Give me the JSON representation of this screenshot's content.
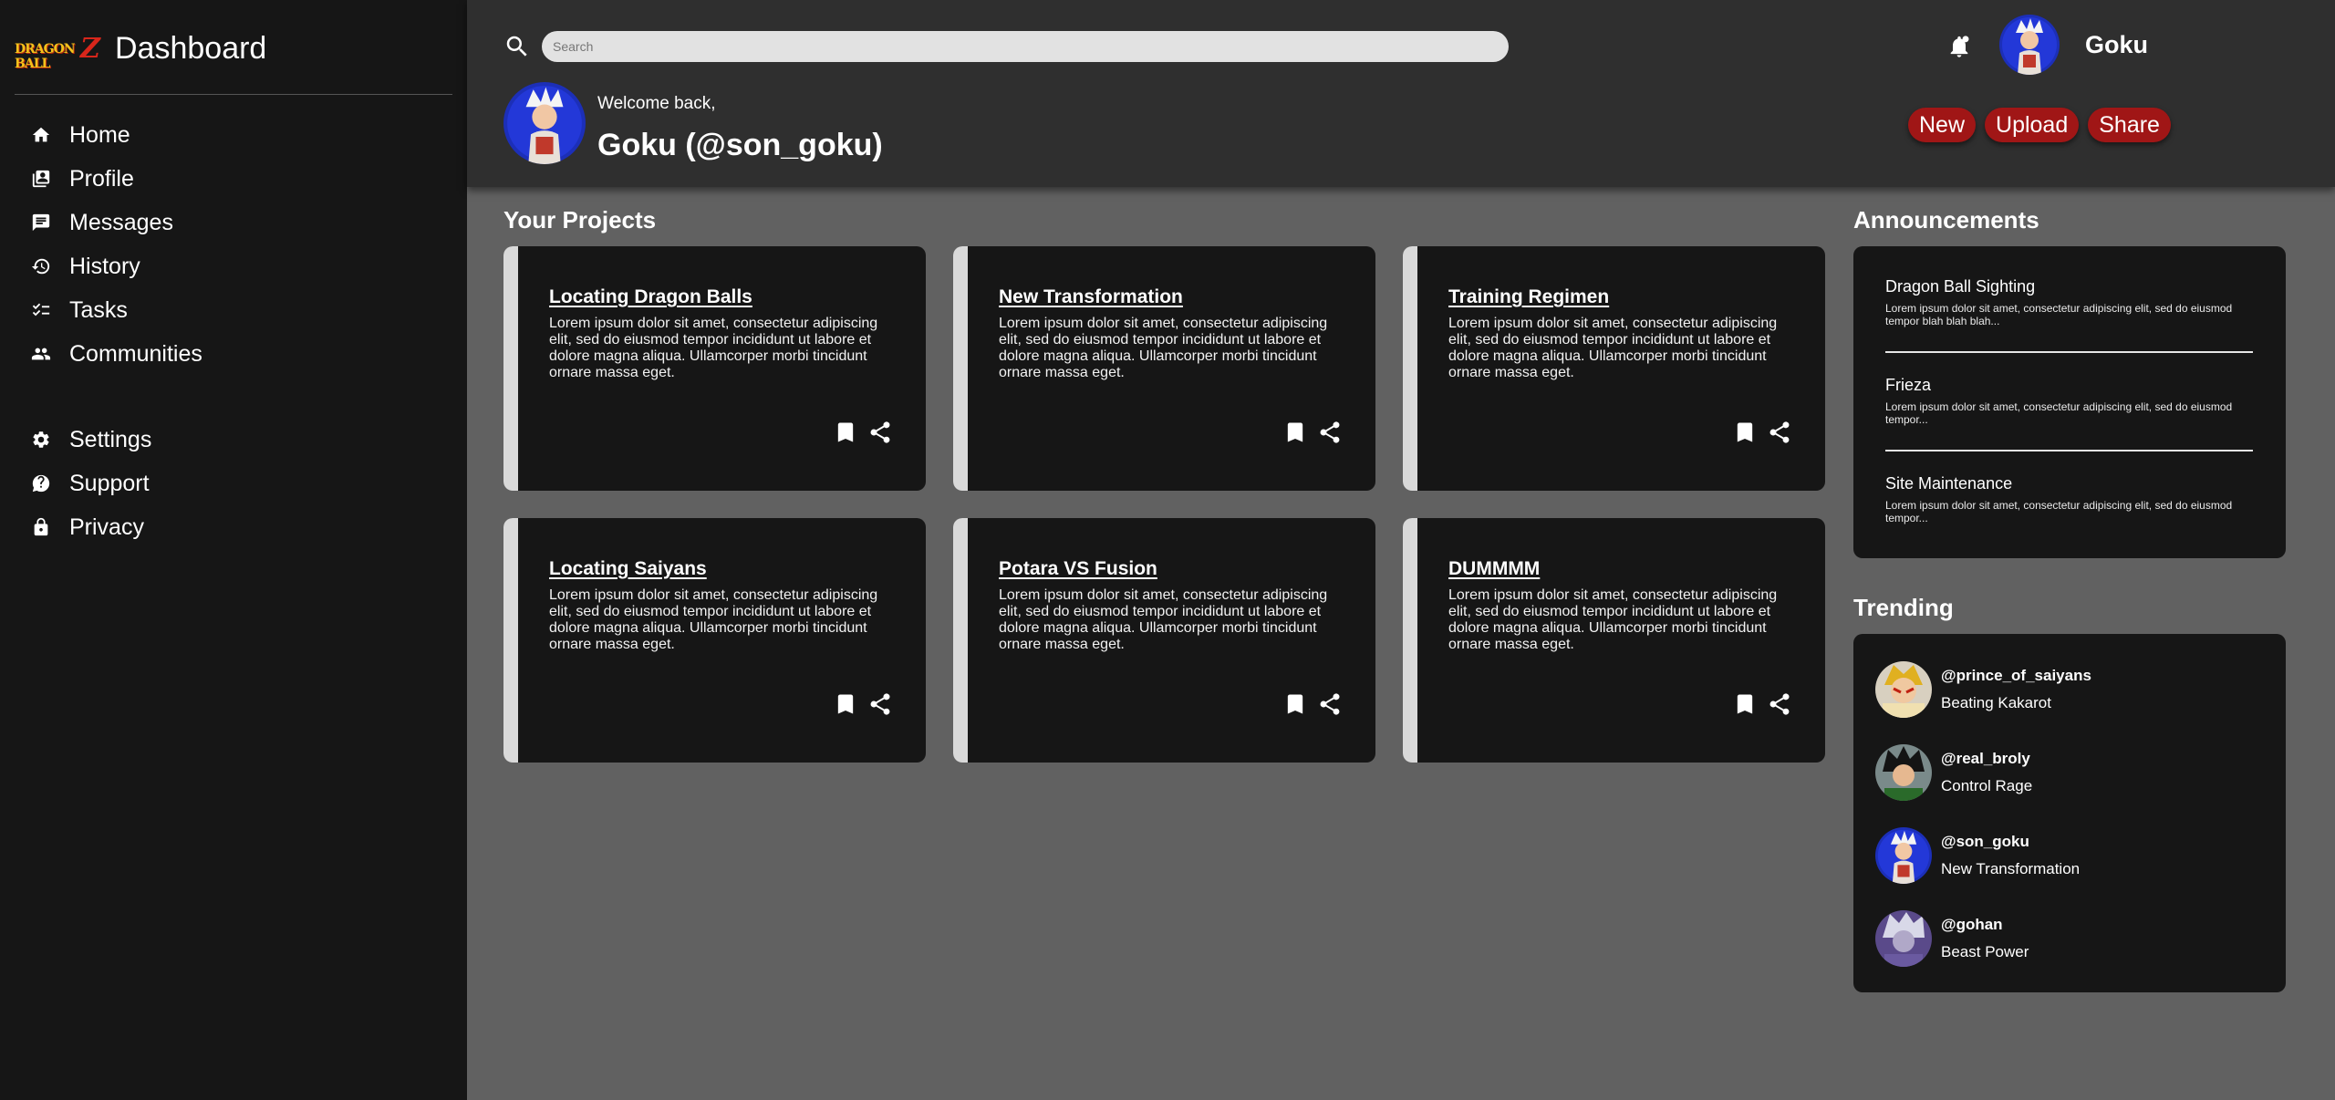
{
  "sidebar": {
    "logo_text": "DRAGON BALL",
    "logo_z": "Z",
    "title": "Dashboard",
    "items_main": [
      {
        "label": "Home",
        "icon": "home-icon"
      },
      {
        "label": "Profile",
        "icon": "profile-icon"
      },
      {
        "label": "Messages",
        "icon": "messages-icon"
      },
      {
        "label": "History",
        "icon": "history-icon"
      },
      {
        "label": "Tasks",
        "icon": "tasks-icon"
      },
      {
        "label": "Communities",
        "icon": "communities-icon"
      }
    ],
    "items_secondary": [
      {
        "label": "Settings",
        "icon": "settings-icon"
      },
      {
        "label": "Support",
        "icon": "support-icon"
      },
      {
        "label": "Privacy",
        "icon": "lock-icon"
      }
    ]
  },
  "header": {
    "search_placeholder": "Search",
    "username": "Goku",
    "welcome": "Welcome back,",
    "fullname": "Goku (@son_goku)",
    "actions": [
      "New",
      "Upload",
      "Share"
    ]
  },
  "projects": {
    "title": "Your Projects",
    "cards": [
      {
        "title": "Locating Dragon Balls",
        "body": "Lorem ipsum dolor sit amet, consectetur adipiscing elit, sed do eiusmod tempor incididunt ut labore et dolore magna aliqua. Ullamcorper morbi tincidunt ornare massa eget."
      },
      {
        "title": "New Transformation",
        "body": "Lorem ipsum dolor sit amet, consectetur adipiscing elit, sed do eiusmod tempor incididunt ut labore et dolore magna aliqua. Ullamcorper morbi tincidunt ornare massa eget."
      },
      {
        "title": "Training Regimen",
        "body": "Lorem ipsum dolor sit amet, consectetur adipiscing elit, sed do eiusmod tempor incididunt ut labore et dolore magna aliqua. Ullamcorper morbi tincidunt ornare massa eget."
      },
      {
        "title": "Locating Saiyans",
        "body": "Lorem ipsum dolor sit amet, consectetur adipiscing elit, sed do eiusmod tempor incididunt ut labore et dolore magna aliqua. Ullamcorper morbi tincidunt ornare massa eget."
      },
      {
        "title": "Potara VS Fusion",
        "body": "Lorem ipsum dolor sit amet, consectetur adipiscing elit, sed do eiusmod tempor incididunt ut labore et dolore magna aliqua. Ullamcorper morbi tincidunt ornare massa eget."
      },
      {
        "title": "DUMMMM",
        "body": "Lorem ipsum dolor sit amet, consectetur adipiscing elit, sed do eiusmod tempor incididunt ut labore et dolore magna aliqua. Ullamcorper morbi tincidunt ornare massa eget."
      }
    ]
  },
  "announcements": {
    "title": "Announcements",
    "items": [
      {
        "title": "Dragon Ball Sighting",
        "body": "Lorem ipsum dolor sit amet, consectetur adipiscing elit, sed do eiusmod tempor blah blah blah..."
      },
      {
        "title": "Frieza",
        "body": "Lorem ipsum dolor sit amet, consectetur adipiscing elit, sed do eiusmod tempor..."
      },
      {
        "title": "Site Maintenance",
        "body": "Lorem ipsum dolor sit amet, consectetur adipiscing elit, sed do eiusmod tempor..."
      }
    ]
  },
  "trending": {
    "title": "Trending",
    "items": [
      {
        "handle": "@prince_of_saiyans",
        "text": "Beating Kakarot"
      },
      {
        "handle": "@real_broly",
        "text": "Control Rage"
      },
      {
        "handle": "@son_goku",
        "text": "New Transformation"
      },
      {
        "handle": "@gohan",
        "text": "Beast Power"
      }
    ]
  },
  "colors": {
    "sidebar_bg": "#161616",
    "header_bg": "#2f2f2f",
    "page_bg": "#616161",
    "card_bg": "#161616",
    "accent": "#a01616"
  }
}
